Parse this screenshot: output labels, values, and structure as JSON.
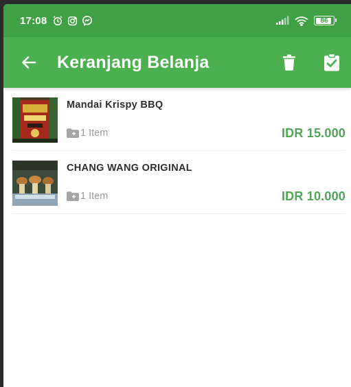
{
  "status_bar": {
    "time": "17:08",
    "battery": "86"
  },
  "app_bar": {
    "title": "Keranjang Belanja"
  },
  "cart": {
    "items": [
      {
        "name": "Mandai Krispy BBQ",
        "quantity": "1 Item",
        "price": "IDR 15.000"
      },
      {
        "name": "CHANG WANG ORIGINAL",
        "quantity": "1 Item",
        "price": "IDR 10.000"
      }
    ]
  },
  "colors": {
    "status_bar": "#3fa044",
    "app_bar": "#4cb050",
    "price": "#4fa657"
  },
  "icons": {
    "back": "arrow-left-icon",
    "delete": "trash-icon",
    "checkout": "clipboard-check-icon",
    "quantity": "folder-add-icon"
  }
}
